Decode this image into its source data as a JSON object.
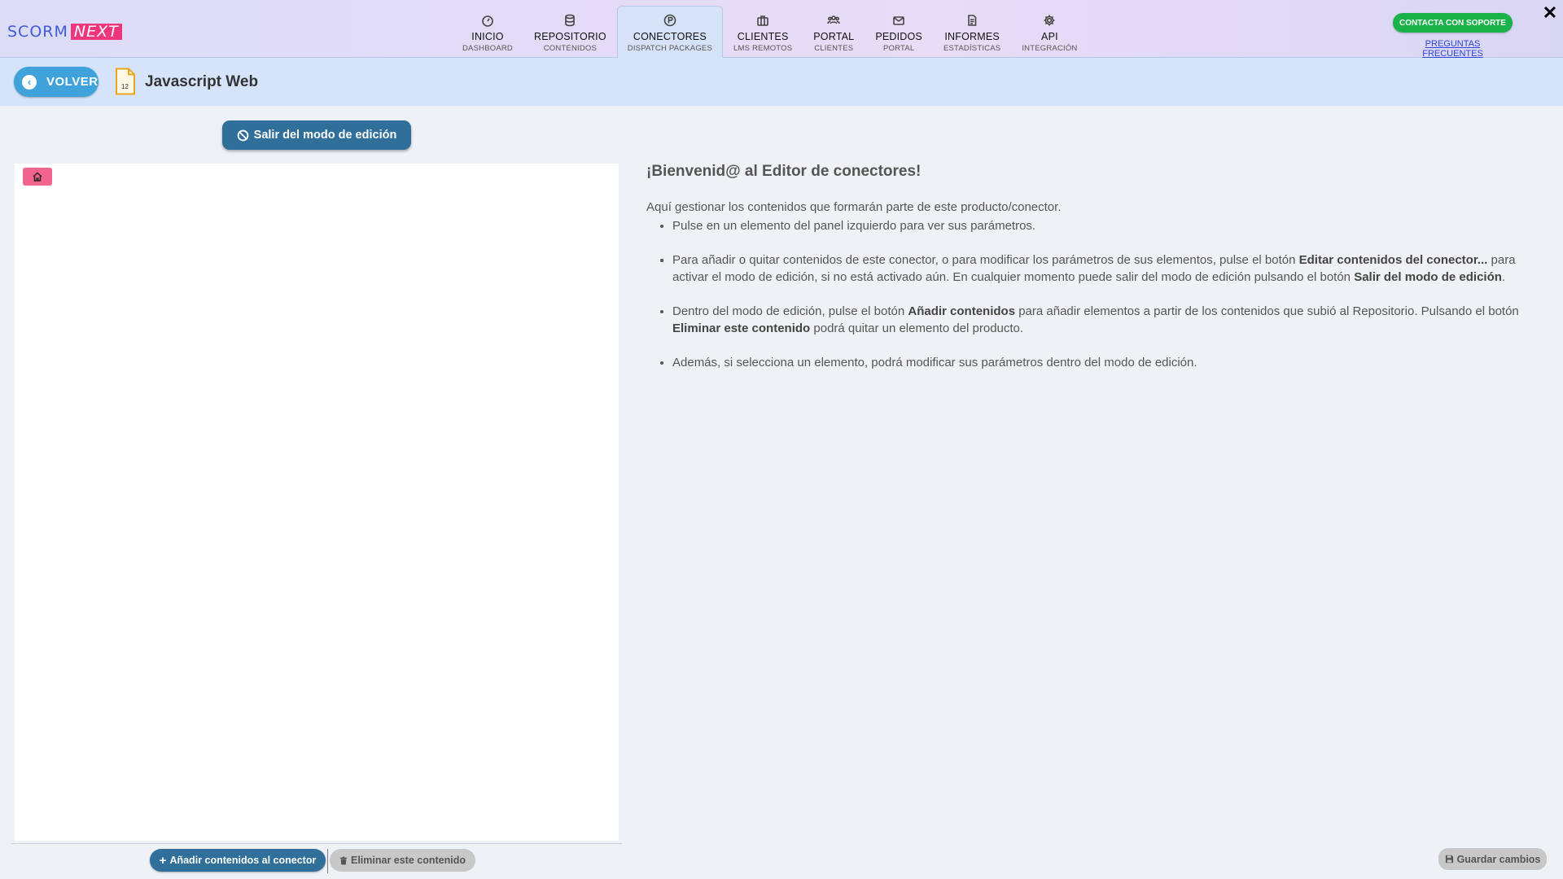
{
  "brand": {
    "part1": "SCORM",
    "part2": "NEXT"
  },
  "nav": [
    {
      "label": "INICIO",
      "sub": "DASHBOARD",
      "icon": "gauge-icon"
    },
    {
      "label": "REPOSITORIO",
      "sub": "CONTENIDOS",
      "icon": "database-icon"
    },
    {
      "label": "CONECTORES",
      "sub": "DISPATCH PACKAGES",
      "icon": "parking-circle-icon",
      "active": true
    },
    {
      "label": "CLIENTES",
      "sub": "LMS REMOTOS",
      "icon": "briefcase-icon"
    },
    {
      "label": "PORTAL",
      "sub": "CLIENTES",
      "icon": "users-icon"
    },
    {
      "label": "PEDIDOS",
      "sub": "PORTAL",
      "icon": "envelope-icon"
    },
    {
      "label": "INFORMES",
      "sub": "ESTADÍSTICAS",
      "icon": "document-icon"
    },
    {
      "label": "API",
      "sub": "INTEGRACIÓN",
      "icon": "gear-icon"
    }
  ],
  "support": {
    "button": "CONTACTA CON SOPORTE",
    "faq": "PREGUNTAS FRECUENTES"
  },
  "close_glyph": "✕",
  "subheader": {
    "back_label": "VOLVER",
    "doc_icon_text": "12",
    "title": "Javascript Web"
  },
  "edit": {
    "exit_label": "Salir del modo de edición"
  },
  "left_footer": {
    "add_label": "Añadir contenidos al conector",
    "delete_label": "Eliminar este contenido"
  },
  "welcome": {
    "title": "¡Bienvenid@ al Editor de conectores!",
    "intro": "Aquí gestionar los contenidos que formarán parte de este producto/conector.",
    "bullet1": "Pulse en un elemento del panel izquierdo para ver sus parámetros.",
    "bullet2_a": "Para añadir o quitar contenidos de este conector, o para modificar los parámetros de sus elementos, pulse el botón ",
    "bullet2_b": "Editar contenidos del conector...",
    "bullet2_c": " para activar el modo de edición, si no está activado aún. En cualquier momento puede salir del modo de edición pulsando el botón ",
    "bullet2_d": "Salir del modo de edición",
    "bullet2_e": ".",
    "bullet3_a": "Dentro del modo de edición, pulse el botón ",
    "bullet3_b": "Añadir contenidos",
    "bullet3_c": " para añadir elementos a partir de los contenidos que subió al Repositorio. Pulsando el botón ",
    "bullet3_d": "Eliminar este contenido",
    "bullet3_e": " podrá quitar un elemento del producto.",
    "bullet4": "Además, si selecciona un elemento, podrá modificar sus parámetros dentro del modo de edición."
  },
  "save_label": "Guardar cambios",
  "colors": {
    "primary": "#2f6f99",
    "back_button": "#3fa2db",
    "support_green": "#19b34a",
    "home_node_pink": "#f1648f",
    "brand_blue": "#3e5bd9",
    "brand_pink": "#f0357f"
  }
}
